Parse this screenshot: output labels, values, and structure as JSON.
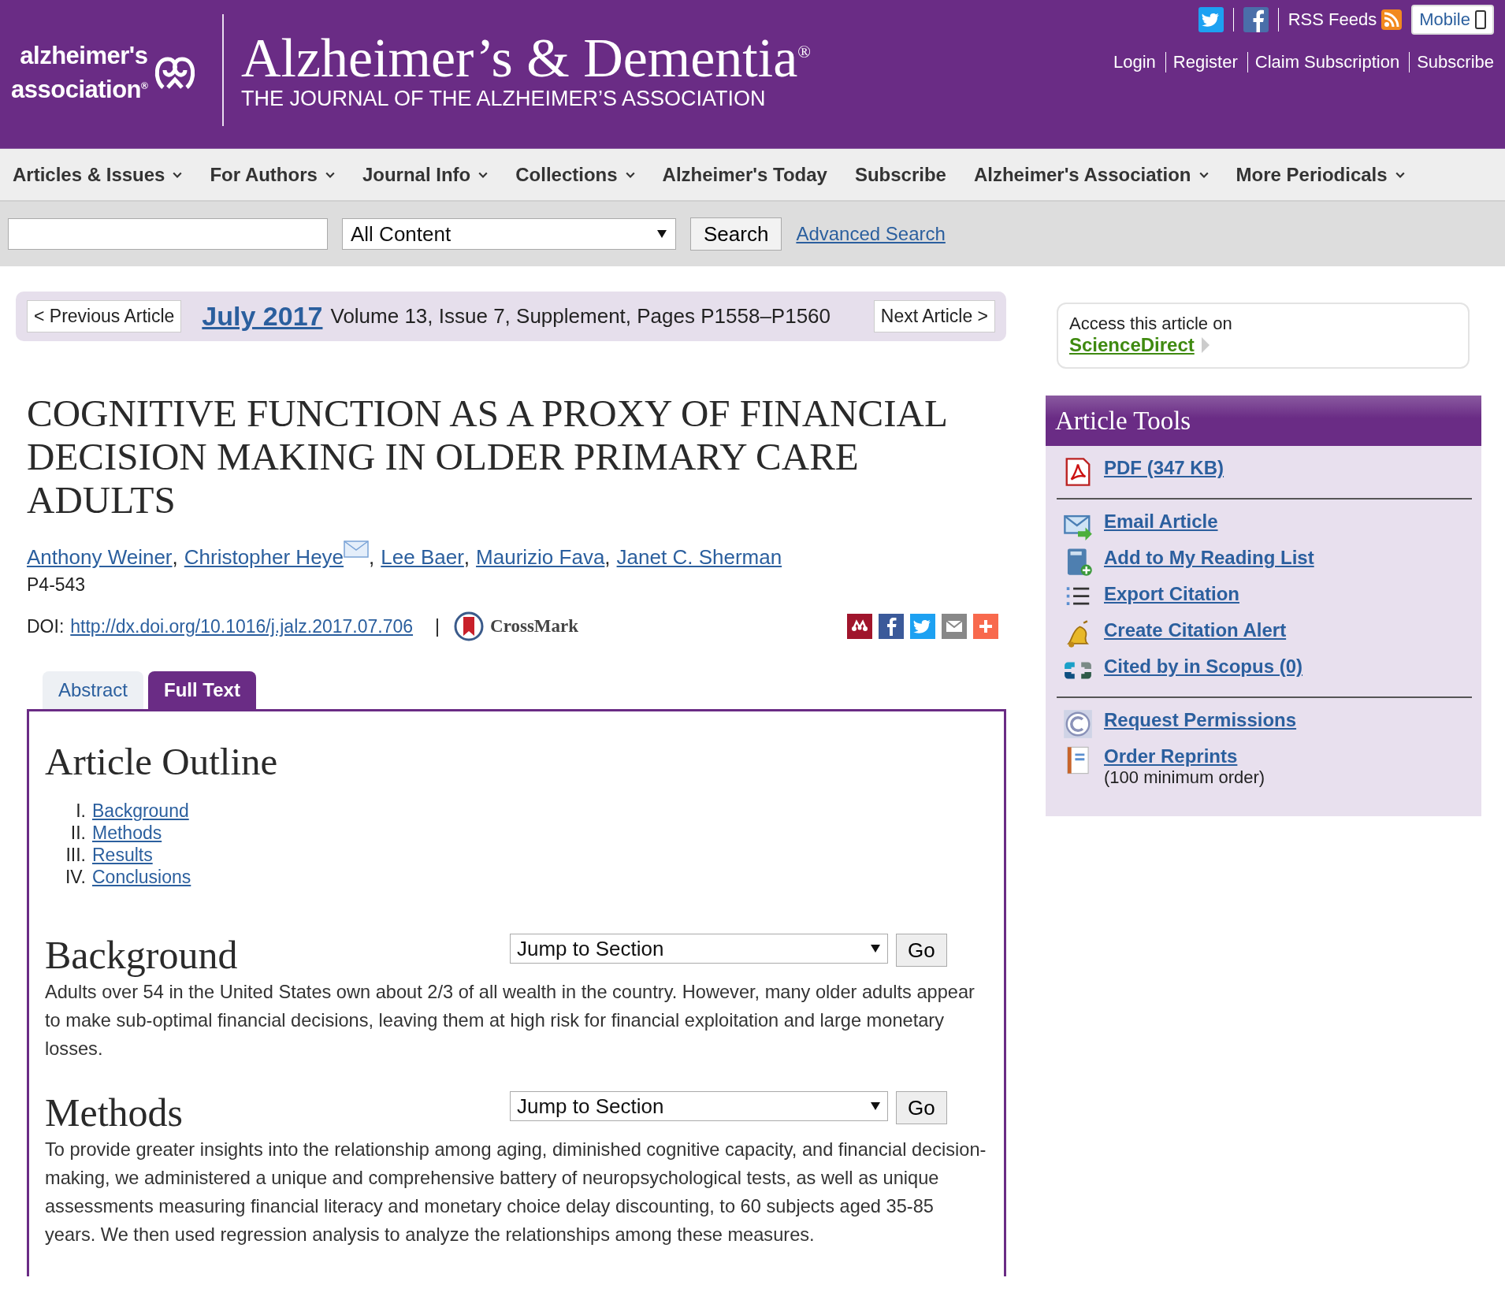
{
  "header": {
    "logo_lines": [
      "alzheimer's",
      "association$^{®}$"
    ],
    "journal_title": "Alzheimer’s & Dementia$^{®}$",
    "journal_subtitle": "THE JOURNAL OF THE ALZHEIMER’S ASSOCIATION",
    "rss_label": "RSS Feeds",
    "mobile_label": "Mobile",
    "account_links": [
      "Login",
      "Register",
      "Claim Subscription",
      "Subscribe"
    ]
  },
  "nav": [
    {
      "label": "Articles & Issues",
      "has_dropdown": true
    },
    {
      "label": "For Authors",
      "has_dropdown": true
    },
    {
      "label": "Journal Info",
      "has_dropdown": true
    },
    {
      "label": "Collections",
      "has_dropdown": true
    },
    {
      "label": "Alzheimer's Today",
      "has_dropdown": false
    },
    {
      "label": "Subscribe",
      "has_dropdown": false
    },
    {
      "label": "Alzheimer's Association",
      "has_dropdown": true
    },
    {
      "label": "More Periodicals",
      "has_dropdown": true
    }
  ],
  "search": {
    "scope": "All Content",
    "button": "Search",
    "advanced_link": "Advanced Search"
  },
  "article_nav": {
    "previous": "< Previous Article",
    "issue_link": "July 2017",
    "issue_details": "Volume 13, Issue 7, Supplement, Pages P1558–P1560",
    "next": "Next Article >"
  },
  "article": {
    "title": "COGNITIVE FUNCTION AS A PROXY OF FINANCIAL DECISION MAKING IN OLDER PRIMARY CARE ADULTS",
    "authors": [
      {
        "name": "Anthony Weiner",
        "email": false
      },
      {
        "name": "Christopher Heye",
        "email": true
      },
      {
        "name": "Lee Baer",
        "email": false
      },
      {
        "name": "Maurizio Fava",
        "email": false
      },
      {
        "name": "Janet C. Sherman",
        "email": false
      }
    ],
    "author_separator": ",",
    "code": "P4-543",
    "doi_label": "DOI:",
    "doi": "http://dx.doi.org/10.1016/j.jalz.2017.07.706",
    "separator": "|",
    "crossmark": "CrossMark"
  },
  "tabs": [
    {
      "label": "Abstract",
      "selected": false
    },
    {
      "label": "Full Text",
      "selected": true
    }
  ],
  "outline": {
    "heading": "Article Outline",
    "items": [
      {
        "numeral": "I.",
        "label": "Background"
      },
      {
        "numeral": "II.",
        "label": "Methods"
      },
      {
        "numeral": "III.",
        "label": "Results"
      },
      {
        "numeral": "IV.",
        "label": "Conclusions"
      }
    ]
  },
  "sections": [
    {
      "heading": "Background",
      "jump_select": "Jump to Section",
      "go_button": "Go",
      "text": "Adults over 54 in the United States own about 2/3 of all wealth in the country. However, many older adults appear to make sub-optimal financial decisions, leaving them at high risk for financial exploitation and large monetary losses."
    },
    {
      "heading": "Methods",
      "jump_select": "Jump to Section",
      "go_button": "Go",
      "text": "To provide greater insights into the relationship among aging, diminished cognitive capacity, and financial decision-making, we administered a unique and comprehensive battery of neuropsychological tests, as well as unique assessments measuring financial literacy and monetary choice delay discounting, to 60 subjects aged 35-85 years. We then used regression analysis to analyze the relationships among these measures."
    }
  ],
  "sidebar": {
    "access_text": "Access this article on",
    "access_link": "ScienceDirect",
    "tools_heading": "Article Tools",
    "tool_groups": [
      [
        {
          "kind": "pdf",
          "label": "PDF (347 KB)"
        }
      ],
      [
        {
          "kind": "email",
          "label": "Email Article"
        },
        {
          "kind": "reading-list",
          "label": "Add to My Reading List"
        },
        {
          "kind": "export",
          "label": "Export Citation"
        },
        {
          "kind": "alert",
          "label": "Create Citation Alert"
        },
        {
          "kind": "scopus",
          "label": "Cited by in Scopus (0)"
        }
      ],
      [
        {
          "kind": "permissions",
          "label": "Request Permissions"
        },
        {
          "kind": "reprints",
          "label": "Order Reprints",
          "note": "(100 minimum order)"
        }
      ]
    ]
  }
}
